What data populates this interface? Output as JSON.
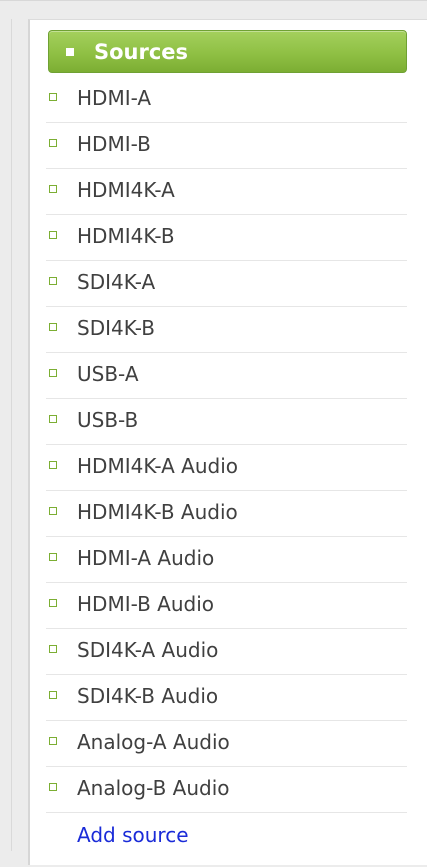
{
  "colors": {
    "header_green": "#8fc044",
    "header_border": "#6fa133",
    "bullet_green": "#7cae33",
    "item_text": "#404040",
    "link_blue": "#1a2bd8"
  },
  "icons": {
    "header_bullet": "white-square-bullet",
    "item_bullet": "green-outline-square-bullet"
  },
  "sources": {
    "title": "Sources",
    "items": [
      {
        "label": "HDMI-A"
      },
      {
        "label": "HDMI-B"
      },
      {
        "label": "HDMI4K-A"
      },
      {
        "label": "HDMI4K-B"
      },
      {
        "label": "SDI4K-A"
      },
      {
        "label": "SDI4K-B"
      },
      {
        "label": "USB-A"
      },
      {
        "label": "USB-B"
      },
      {
        "label": "HDMI4K-A Audio"
      },
      {
        "label": "HDMI4K-B Audio"
      },
      {
        "label": "HDMI-A Audio"
      },
      {
        "label": "HDMI-B Audio"
      },
      {
        "label": "SDI4K-A Audio"
      },
      {
        "label": "SDI4K-B Audio"
      },
      {
        "label": "Analog-A Audio"
      },
      {
        "label": "Analog-B Audio"
      }
    ],
    "add_label": "Add source"
  }
}
